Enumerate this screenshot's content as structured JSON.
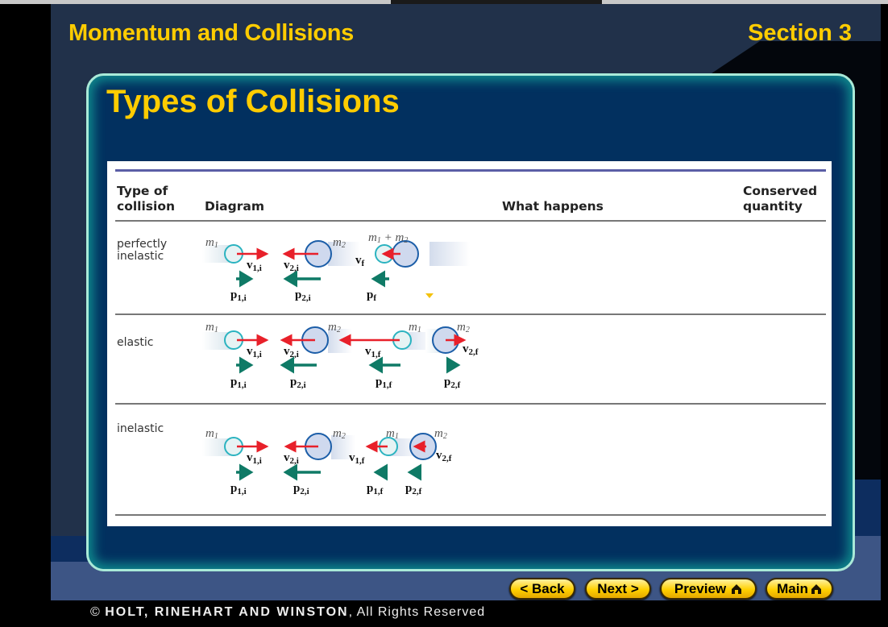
{
  "header": {
    "title": "Momentum and Collisions",
    "section": "Section 3"
  },
  "panel": {
    "title": "Types of Collisions"
  },
  "table": {
    "columns": [
      "Type of collision",
      "Diagram",
      "What happens",
      "Conserved quantity"
    ],
    "col_type_line1": "Type of",
    "col_type_line2": "collision",
    "col_conserved_line1": "Conserved",
    "col_conserved_line2": "quantity",
    "rows": [
      {
        "type_line1": "perfectly",
        "type_line2": "inelastic",
        "diagram": {
          "labels": [
            "m1",
            "m2",
            "m1 + m2",
            "v1,i",
            "v2,i",
            "vf",
            "p1,i",
            "p2,i",
            "pf"
          ]
        },
        "what_happens": "",
        "conserved": ""
      },
      {
        "type_line1": "elastic",
        "type_line2": "",
        "diagram": {
          "labels": [
            "m1",
            "m2",
            "m1",
            "m2",
            "v1,i",
            "v2,i",
            "v1,f",
            "v2,f",
            "p1,i",
            "p2,i",
            "p1,f",
            "p2,f"
          ]
        },
        "what_happens": "",
        "conserved": ""
      },
      {
        "type_line1": "inelastic",
        "type_line2": "",
        "diagram": {
          "labels": [
            "m1",
            "m2",
            "m1",
            "m2",
            "v1,i",
            "v2,i",
            "v1,f",
            "v2,f",
            "p1,i",
            "p2,i",
            "p1,f",
            "p2,f"
          ]
        },
        "what_happens": "",
        "conserved": ""
      }
    ]
  },
  "nav": {
    "back": "< Back",
    "next": "Next >",
    "preview": "Preview",
    "main": "Main"
  },
  "footer": {
    "copyright_symbol": "©",
    "publisher": "HOLT, RINEHART AND WINSTON",
    "rights": ", All Rights Reserved"
  },
  "colors": {
    "accent_yellow": "#ffcc00",
    "panel_blue": "#02305f",
    "velocity_arrow": "#e8202a",
    "momentum_arrow": "#0f7a66"
  }
}
